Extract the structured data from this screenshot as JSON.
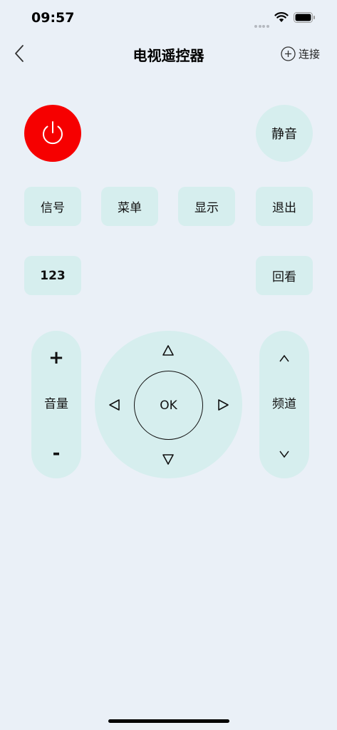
{
  "status_bar": {
    "time": "09:57"
  },
  "nav": {
    "title": "电视遥控器",
    "connect_label": "连接"
  },
  "buttons": {
    "mute": "静音",
    "signal": "信号",
    "menu": "菜单",
    "display": "显示",
    "exit": "退出",
    "numbers": "123",
    "replay": "回看",
    "ok": "OK"
  },
  "volume": {
    "up": "+",
    "label": "音量",
    "down": "-"
  },
  "channel": {
    "label": "频道"
  },
  "colors": {
    "background": "#eaf0f7",
    "button": "#d6eeee",
    "power": "#f60000"
  }
}
